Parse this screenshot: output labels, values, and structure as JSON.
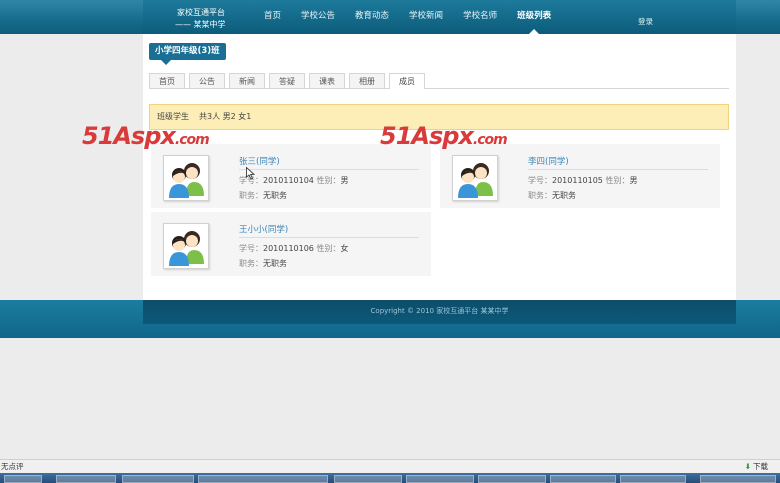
{
  "header": {
    "brand_line1": "家校互通平台",
    "brand_line2": "—— 某某中学",
    "nav": [
      {
        "label": "首页",
        "active": false
      },
      {
        "label": "学校公告",
        "active": false
      },
      {
        "label": "教育动态",
        "active": false
      },
      {
        "label": "学校新闻",
        "active": false
      },
      {
        "label": "学校名师",
        "active": false
      },
      {
        "label": "班级列表",
        "active": true
      }
    ],
    "login": "登录"
  },
  "class_title": "小学四年级(3)班",
  "tabs": [
    {
      "label": "首页",
      "active": false
    },
    {
      "label": "公告",
      "active": false
    },
    {
      "label": "新闻",
      "active": false
    },
    {
      "label": "答疑",
      "active": false
    },
    {
      "label": "课表",
      "active": false
    },
    {
      "label": "相册",
      "active": false
    },
    {
      "label": "成员",
      "active": true
    }
  ],
  "notice": {
    "title": "班级学生",
    "summary": "共3人 男2 女1"
  },
  "labels": {
    "id": "学号：",
    "gender": "性别：",
    "role": "职务："
  },
  "students": [
    {
      "name": "张三(同学)",
      "id": "2010110104",
      "gender": "男",
      "role": "无职务"
    },
    {
      "name": "李四(同学)",
      "id": "2010110105",
      "gender": "男",
      "role": "无职务"
    },
    {
      "name": "王小小(同学)",
      "id": "2010110106",
      "gender": "女",
      "role": "无职务"
    }
  ],
  "footer": "Copyright © 2010 家校互通平台 某某中学",
  "statusbar": {
    "left": "无点评",
    "download": "下载"
  },
  "watermark": {
    "main": "51Aspx",
    "suffix": ".com"
  },
  "colors": {
    "accent": "#1a6f94",
    "link": "#3a86b8",
    "notice_bg": "#fdeeb8",
    "watermark": "#d93b3b"
  }
}
